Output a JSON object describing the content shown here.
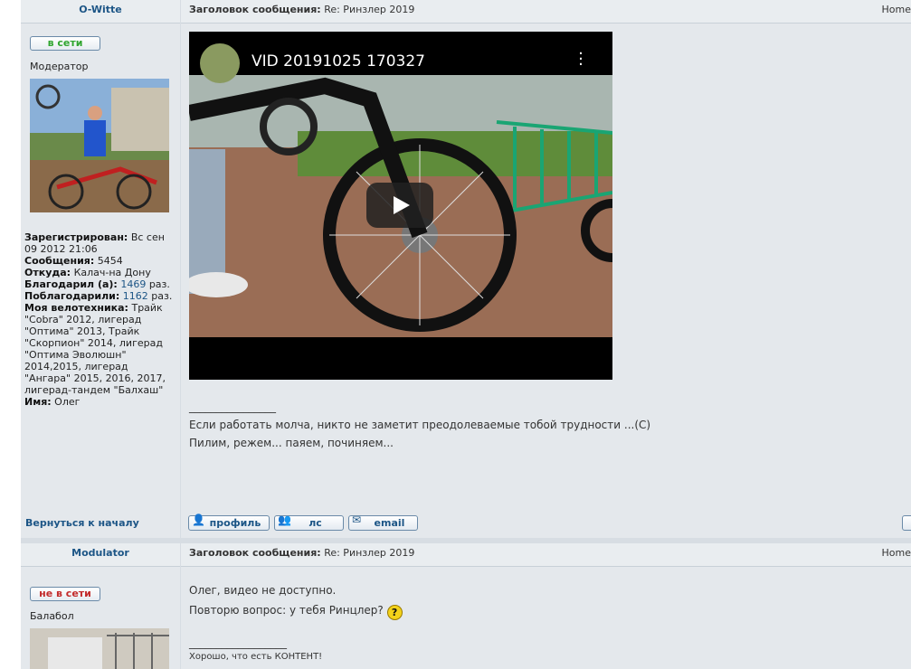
{
  "header_home": "Home",
  "post1": {
    "author": "O-Witte",
    "status": "в сети",
    "rank": "Модератор",
    "subject_label": "Заголовок сообщения:",
    "subject": "Re: Ринзлер 2019",
    "profile": {
      "registered_label": "Зарегистрирован:",
      "registered": "Вс сен 09 2012 21:06",
      "posts_label": "Сообщения:",
      "posts": "5454",
      "from_label": "Откуда:",
      "from": "Калач-на Дону",
      "thanked_label": "Благодарил (а):",
      "thanked": "1469",
      "thanked_by_label": "Поблагодарили:",
      "thanked_by": "1162",
      "times": "раз.",
      "bikes_label": "Моя велотехника:",
      "bikes": "Трайк \"Cobra\" 2012, лигерад \"Оптима\" 2013, Трайк \"Скорпион\" 2014, лигерад \"Оптима Эволюшн\" 2014,2015, лигерад \"Ангара\" 2015, 2016, 2017, лигерад-тандем \"Балхаш\"",
      "name_label": "Имя:",
      "name": "Олег"
    },
    "video_title": "VID 20191025 170327",
    "sig_line": "________________",
    "sig1": "Если работать молча, никто не заметит преодолеваемые тобой трудности ...(C)",
    "sig2": "Пилим, режем... паяем, починяем...",
    "back_to_top": "Вернуться к началу",
    "buttons": {
      "profile": "профиль",
      "pm": "лс",
      "email": "email"
    }
  },
  "post2": {
    "author": "Modulator",
    "status": "не в сети",
    "rank": "Балабол",
    "subject_label": "Заголовок сообщения:",
    "subject": "Re: Ринзлер 2019",
    "msg1": "Олег, видео не доступно.",
    "msg2": "Повторю вопрос: у тебя Ринцлер?",
    "sig_line": "__________________",
    "sig1": "Хорошо, что есть КОНТЕНТ!"
  },
  "colors": {
    "link": "#1c5586",
    "online": "#2fa52f",
    "offline": "#c22a2a",
    "panel": "#e4e8ec"
  }
}
